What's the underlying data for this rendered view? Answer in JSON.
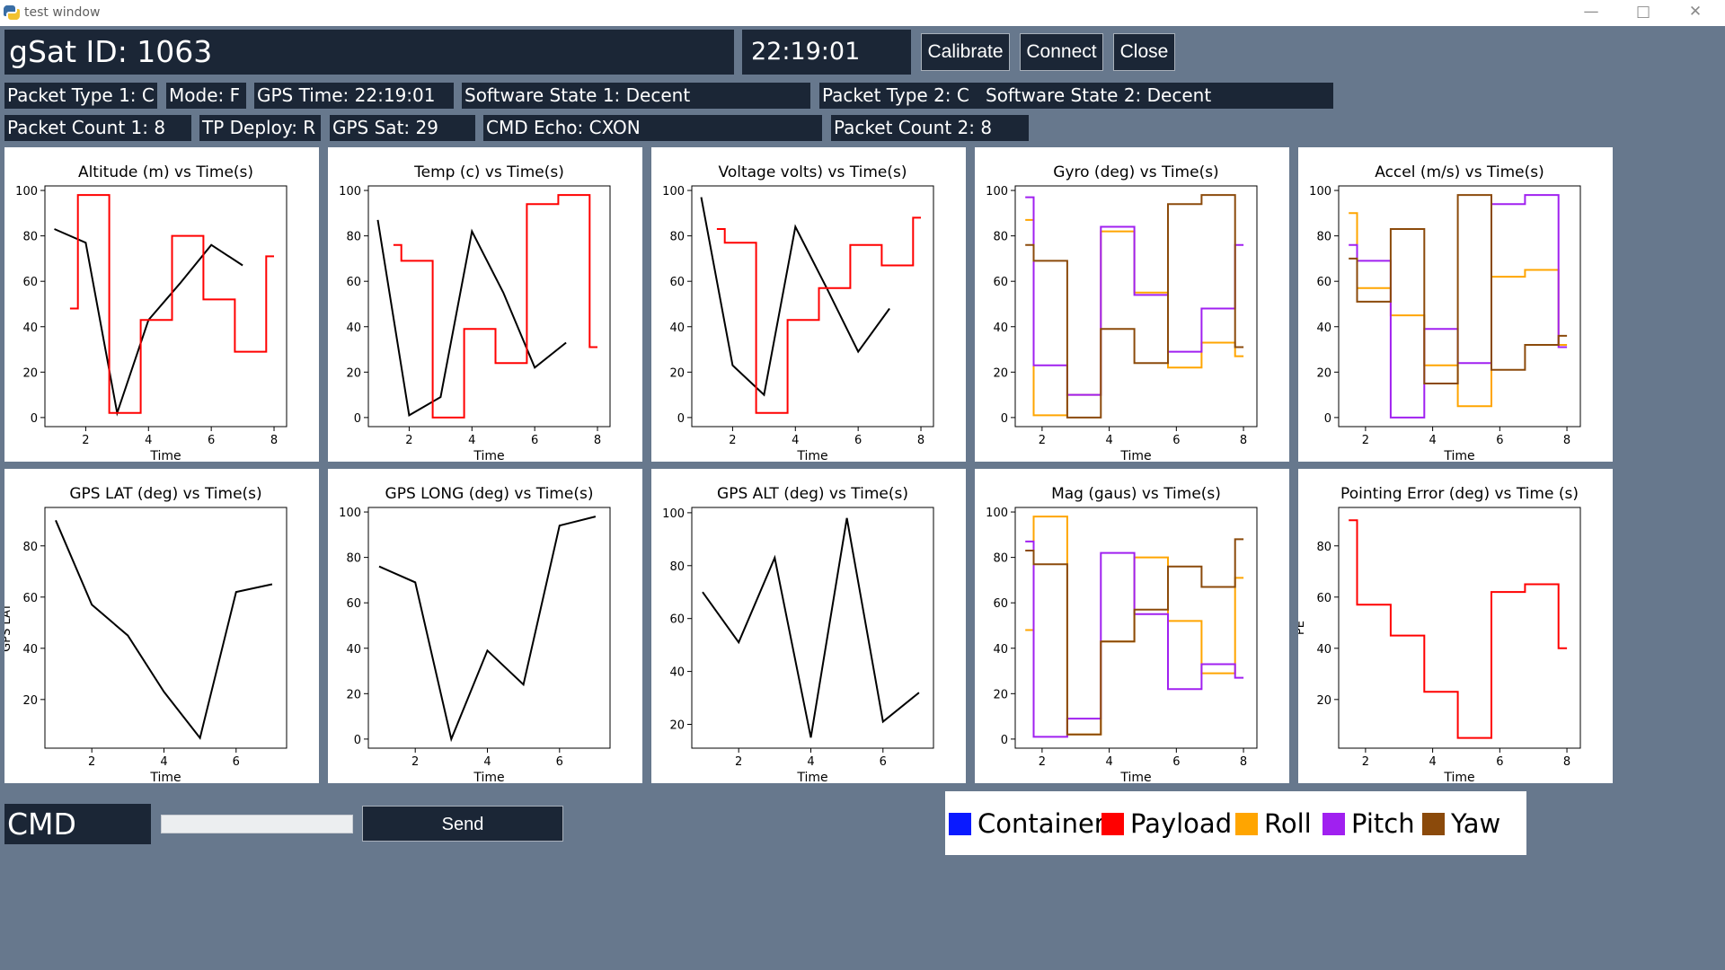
{
  "window": {
    "title": "test window"
  },
  "header": {
    "gsat_id": "gSat ID: 1063",
    "clock": "22:19:01",
    "buttons": {
      "calibrate": "Calibrate",
      "connect": "Connect",
      "close": "Close"
    }
  },
  "status_row1": [
    "Packet Type 1: C",
    "Mode: F",
    "GPS Time: 22:19:01",
    "Software State 1: Decent",
    "Packet Type 2: C",
    "Software State 2: Decent"
  ],
  "status_row2": [
    "Packet Count 1: 8",
    "TP Deploy: R",
    "GPS Sat: 29",
    "CMD Echo: CXON",
    "Packet Count 2: 8"
  ],
  "command": {
    "label": "CMD",
    "value": "",
    "send_label": "Send"
  },
  "colors": {
    "Container": "#0a1aff",
    "Payload": "#ff0000",
    "Roll": "#ffa500",
    "Pitch": "#a020f0",
    "Yaw": "#8b4a0b",
    "black": "#000000"
  },
  "legend": [
    {
      "label": "Container",
      "color": "#0a1aff"
    },
    {
      "label": "Payload",
      "color": "#ff0000"
    },
    {
      "label": "Roll",
      "color": "#ffa500"
    },
    {
      "label": "Pitch",
      "color": "#a020f0"
    },
    {
      "label": "Yaw",
      "color": "#8b4a0b"
    }
  ],
  "chart_data": [
    {
      "type": "line",
      "title": "Altitude (m) vs Time(s)",
      "xlabel": "Time",
      "ylabel": "",
      "xlim": [
        0.7,
        8.4
      ],
      "ylim": [
        -4,
        102
      ],
      "xticks": [
        2,
        4,
        6,
        8
      ],
      "yticks": [
        0,
        20,
        40,
        60,
        80,
        100
      ],
      "series": [
        {
          "color": "black",
          "step": false,
          "x": [
            1,
            2,
            3,
            4,
            5,
            6,
            7
          ],
          "y": [
            83,
            77,
            2,
            43,
            59,
            76,
            67
          ]
        },
        {
          "color": "Payload",
          "step": true,
          "x": [
            1.5,
            2,
            3,
            4,
            5,
            6,
            7,
            8
          ],
          "y": [
            48,
            98,
            2,
            43,
            80,
            52,
            29,
            71
          ]
        }
      ]
    },
    {
      "type": "line",
      "title": "Temp (c) vs Time(s)",
      "xlabel": "Time",
      "ylabel": "",
      "xlim": [
        0.7,
        8.4
      ],
      "ylim": [
        -4,
        102
      ],
      "xticks": [
        2,
        4,
        6,
        8
      ],
      "yticks": [
        0,
        20,
        40,
        60,
        80,
        100
      ],
      "series": [
        {
          "color": "black",
          "step": false,
          "x": [
            1,
            2,
            3,
            4,
            5,
            6,
            7
          ],
          "y": [
            87,
            1,
            9,
            82,
            55,
            22,
            33
          ]
        },
        {
          "color": "Payload",
          "step": true,
          "x": [
            1.5,
            2,
            3,
            4,
            5,
            6,
            7,
            8
          ],
          "y": [
            76,
            69,
            0,
            39,
            24,
            94,
            98,
            31
          ]
        }
      ]
    },
    {
      "type": "line",
      "title": "Voltage volts) vs Time(s)",
      "xlabel": "Time",
      "ylabel": "",
      "xlim": [
        0.7,
        8.4
      ],
      "ylim": [
        -4,
        102
      ],
      "xticks": [
        2,
        4,
        6,
        8
      ],
      "yticks": [
        0,
        20,
        40,
        60,
        80,
        100
      ],
      "series": [
        {
          "color": "black",
          "step": false,
          "x": [
            1,
            2,
            3,
            4,
            5,
            6,
            7
          ],
          "y": [
            97,
            23,
            10,
            84,
            57,
            29,
            48
          ]
        },
        {
          "color": "Payload",
          "step": true,
          "x": [
            1.5,
            2,
            3,
            4,
            5,
            6,
            7,
            8
          ],
          "y": [
            83,
            77,
            2,
            43,
            57,
            76,
            67,
            88
          ]
        }
      ]
    },
    {
      "type": "line",
      "title": "Gyro (deg) vs Time(s)",
      "xlabel": "Time",
      "ylabel": "",
      "xlim": [
        1.2,
        8.4
      ],
      "ylim": [
        -4,
        102
      ],
      "xticks": [
        2,
        4,
        6,
        8
      ],
      "yticks": [
        0,
        20,
        40,
        60,
        80,
        100
      ],
      "series": [
        {
          "color": "Roll",
          "step": true,
          "x": [
            1.5,
            2,
            3,
            4,
            5,
            6,
            7,
            8
          ],
          "y": [
            87,
            1,
            10,
            82,
            55,
            22,
            33,
            27
          ]
        },
        {
          "color": "Pitch",
          "step": true,
          "x": [
            1.5,
            2,
            3,
            4,
            5,
            6,
            7,
            8
          ],
          "y": [
            97,
            23,
            10,
            84,
            54,
            29,
            48,
            76
          ]
        },
        {
          "color": "Yaw",
          "step": true,
          "x": [
            1.5,
            2,
            3,
            4,
            5,
            6,
            7,
            8
          ],
          "y": [
            76,
            69,
            0,
            39,
            24,
            94,
            98,
            31
          ]
        }
      ]
    },
    {
      "type": "line",
      "title": "Accel (m/s) vs Time(s)",
      "xlabel": "Time",
      "ylabel": "",
      "xlim": [
        1.2,
        8.4
      ],
      "ylim": [
        -4,
        102
      ],
      "xticks": [
        2,
        4,
        6,
        8
      ],
      "yticks": [
        0,
        20,
        40,
        60,
        80,
        100
      ],
      "series": [
        {
          "color": "Roll",
          "step": true,
          "x": [
            1.5,
            2,
            3,
            4,
            5,
            6,
            7,
            8
          ],
          "y": [
            90,
            57,
            45,
            23,
            5,
            62,
            65,
            32
          ]
        },
        {
          "color": "Pitch",
          "step": true,
          "x": [
            1.5,
            2,
            3,
            4,
            5,
            6,
            7,
            8
          ],
          "y": [
            76,
            69,
            0,
            39,
            24,
            94,
            98,
            31
          ]
        },
        {
          "color": "Yaw",
          "step": true,
          "x": [
            1.5,
            2,
            3,
            4,
            5,
            6,
            7,
            8
          ],
          "y": [
            70,
            51,
            83,
            15,
            98,
            21,
            32,
            36
          ]
        }
      ]
    },
    {
      "type": "line",
      "title": "GPS LAT (deg) vs Time(s)",
      "xlabel": "Time",
      "ylabel": "GPS LAT",
      "xlim": [
        0.7,
        7.4
      ],
      "ylim": [
        1,
        95
      ],
      "xticks": [
        2,
        4,
        6
      ],
      "yticks": [
        20,
        40,
        60,
        80
      ],
      "series": [
        {
          "color": "black",
          "step": false,
          "x": [
            1,
            2,
            3,
            4,
            5,
            6,
            7
          ],
          "y": [
            90,
            57,
            45,
            23,
            5,
            62,
            65
          ]
        }
      ]
    },
    {
      "type": "line",
      "title": "GPS LONG (deg) vs Time(s)",
      "xlabel": "Time",
      "ylabel": "",
      "xlim": [
        0.7,
        7.4
      ],
      "ylim": [
        -4,
        102
      ],
      "xticks": [
        2,
        4,
        6
      ],
      "yticks": [
        0,
        20,
        40,
        60,
        80,
        100
      ],
      "series": [
        {
          "color": "black",
          "step": false,
          "x": [
            1,
            2,
            3,
            4,
            5,
            6,
            7
          ],
          "y": [
            76,
            69,
            0,
            39,
            24,
            94,
            98
          ]
        }
      ]
    },
    {
      "type": "line",
      "title": "GPS ALT (deg) vs Time(s)",
      "xlabel": "Time",
      "ylabel": "",
      "xlim": [
        0.7,
        7.4
      ],
      "ylim": [
        11,
        102
      ],
      "xticks": [
        2,
        4,
        6
      ],
      "yticks": [
        20,
        40,
        60,
        80,
        100
      ],
      "series": [
        {
          "color": "black",
          "step": false,
          "x": [
            1,
            2,
            3,
            4,
            5,
            6,
            7
          ],
          "y": [
            70,
            51,
            83,
            15,
            98,
            21,
            32
          ]
        }
      ]
    },
    {
      "type": "line",
      "title": "Mag (gaus) vs Time(s)",
      "xlabel": "Time",
      "ylabel": "",
      "xlim": [
        1.2,
        8.4
      ],
      "ylim": [
        -4,
        102
      ],
      "xticks": [
        2,
        4,
        6,
        8
      ],
      "yticks": [
        0,
        20,
        40,
        60,
        80,
        100
      ],
      "series": [
        {
          "color": "Roll",
          "step": true,
          "x": [
            1.5,
            2,
            3,
            4,
            5,
            6,
            7,
            8
          ],
          "y": [
            48,
            98,
            2,
            43,
            80,
            52,
            29,
            71
          ]
        },
        {
          "color": "Pitch",
          "step": true,
          "x": [
            1.5,
            2,
            3,
            4,
            5,
            6,
            7,
            8
          ],
          "y": [
            87,
            1,
            9,
            82,
            55,
            22,
            33,
            27
          ]
        },
        {
          "color": "Yaw",
          "step": true,
          "x": [
            1.5,
            2,
            3,
            4,
            5,
            6,
            7,
            8
          ],
          "y": [
            83,
            77,
            2,
            43,
            57,
            76,
            67,
            88
          ]
        }
      ]
    },
    {
      "type": "line",
      "title": "Pointing Error (deg) vs Time (s)",
      "xlabel": "Time",
      "ylabel": "PE",
      "xlim": [
        1.2,
        8.4
      ],
      "ylim": [
        1,
        95
      ],
      "xticks": [
        2,
        4,
        6,
        8
      ],
      "yticks": [
        20,
        40,
        60,
        80
      ],
      "series": [
        {
          "color": "Payload",
          "step": true,
          "x": [
            1.5,
            2,
            3,
            4,
            5,
            6,
            7,
            8
          ],
          "y": [
            90,
            57,
            45,
            23,
            5,
            62,
            65,
            40
          ]
        }
      ]
    }
  ]
}
